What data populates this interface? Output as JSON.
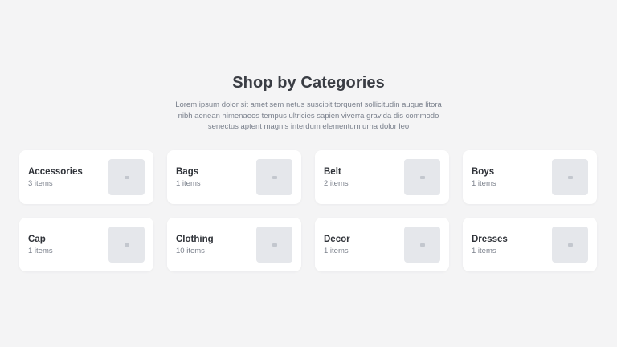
{
  "section": {
    "title": "Shop by Categories",
    "description": "Lorem ipsum dolor sit amet sem netus suscipit torquent sollicitudin augue litora nibh aenean himenaeos tempus ultricies sapien viverra gravida dis commodo senectus aptent magnis interdum elementum urna dolor leo"
  },
  "categories": [
    {
      "name": "Accessories",
      "count": "3 items",
      "icon": "image-placeholder-icon"
    },
    {
      "name": "Bags",
      "count": "1 items",
      "icon": "image-placeholder-icon"
    },
    {
      "name": "Belt",
      "count": "2 items",
      "icon": "image-placeholder-icon"
    },
    {
      "name": "Boys",
      "count": "1 items",
      "icon": "image-placeholder-icon"
    },
    {
      "name": "Cap",
      "count": "1 items",
      "icon": "image-placeholder-icon"
    },
    {
      "name": "Clothing",
      "count": "10 items",
      "icon": "image-placeholder-icon"
    },
    {
      "name": "Decor",
      "count": "1 items",
      "icon": "image-placeholder-icon"
    },
    {
      "name": "Dresses",
      "count": "1 items",
      "icon": "image-placeholder-icon"
    }
  ],
  "colors": {
    "background": "#f4f4f5",
    "card": "#ffffff",
    "thumbnail": "#e5e7eb",
    "title_text": "#3a3d44",
    "muted_text": "#7a808c"
  }
}
